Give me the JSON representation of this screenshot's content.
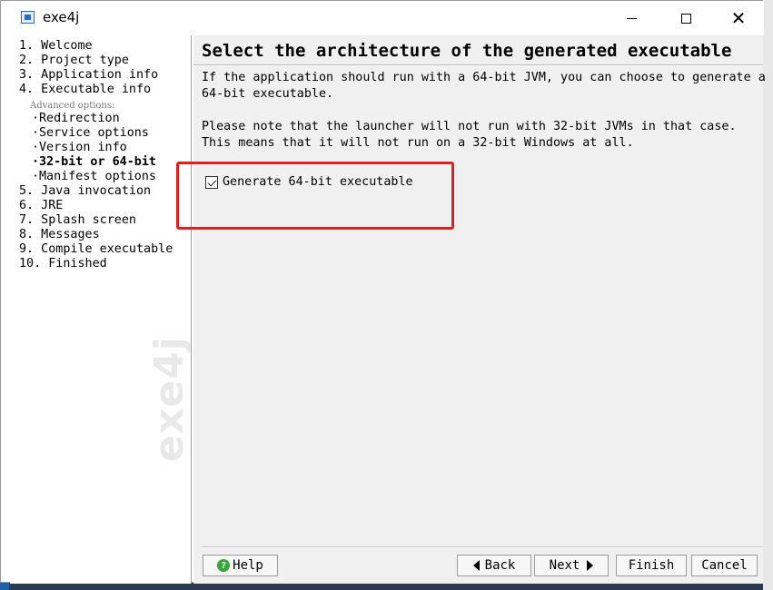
{
  "window": {
    "title": "exe4j",
    "close_glyph": "✕"
  },
  "steps": [
    {
      "label": "1.  Welcome"
    },
    {
      "label": "2.  Project type"
    },
    {
      "label": "3.  Application info"
    },
    {
      "label": "4.  Executable info"
    },
    {
      "label": "Redirection"
    },
    {
      "label": "Service options"
    },
    {
      "label": "Version info"
    },
    {
      "label": "32-bit or 64-bit",
      "current": true
    },
    {
      "label": "Manifest options"
    },
    {
      "label": "5.  Java invocation"
    },
    {
      "label": "6.  JRE"
    },
    {
      "label": "7.  Splash screen"
    },
    {
      "label": "8.  Messages"
    },
    {
      "label": "9.  Compile executable"
    },
    {
      "label": "10.  Finished"
    }
  ],
  "advanced_label": "Advanced options:",
  "sub_bullet": "·",
  "watermark": "exe4j",
  "content": {
    "heading": "Select the architecture of the generated executable",
    "paragraph1": [
      "If the application should run with a 64-bit JVM, you can choose to generate a",
      "64-bit executable."
    ],
    "paragraph2": [
      "Please note that the launcher will not run with 32-bit JVMs in that case.",
      "This means that it will not run on a 32-bit Windows at all."
    ],
    "checkbox": {
      "label": "Generate 64-bit executable",
      "checked": true
    }
  },
  "buttons": {
    "help": "Help",
    "help_glyph": "?",
    "back": "Back",
    "next": "Next",
    "finish": "Finish",
    "cancel": "Cancel"
  },
  "colors": {
    "annotation": "#e02020",
    "help_icon": "#3aa63a"
  }
}
